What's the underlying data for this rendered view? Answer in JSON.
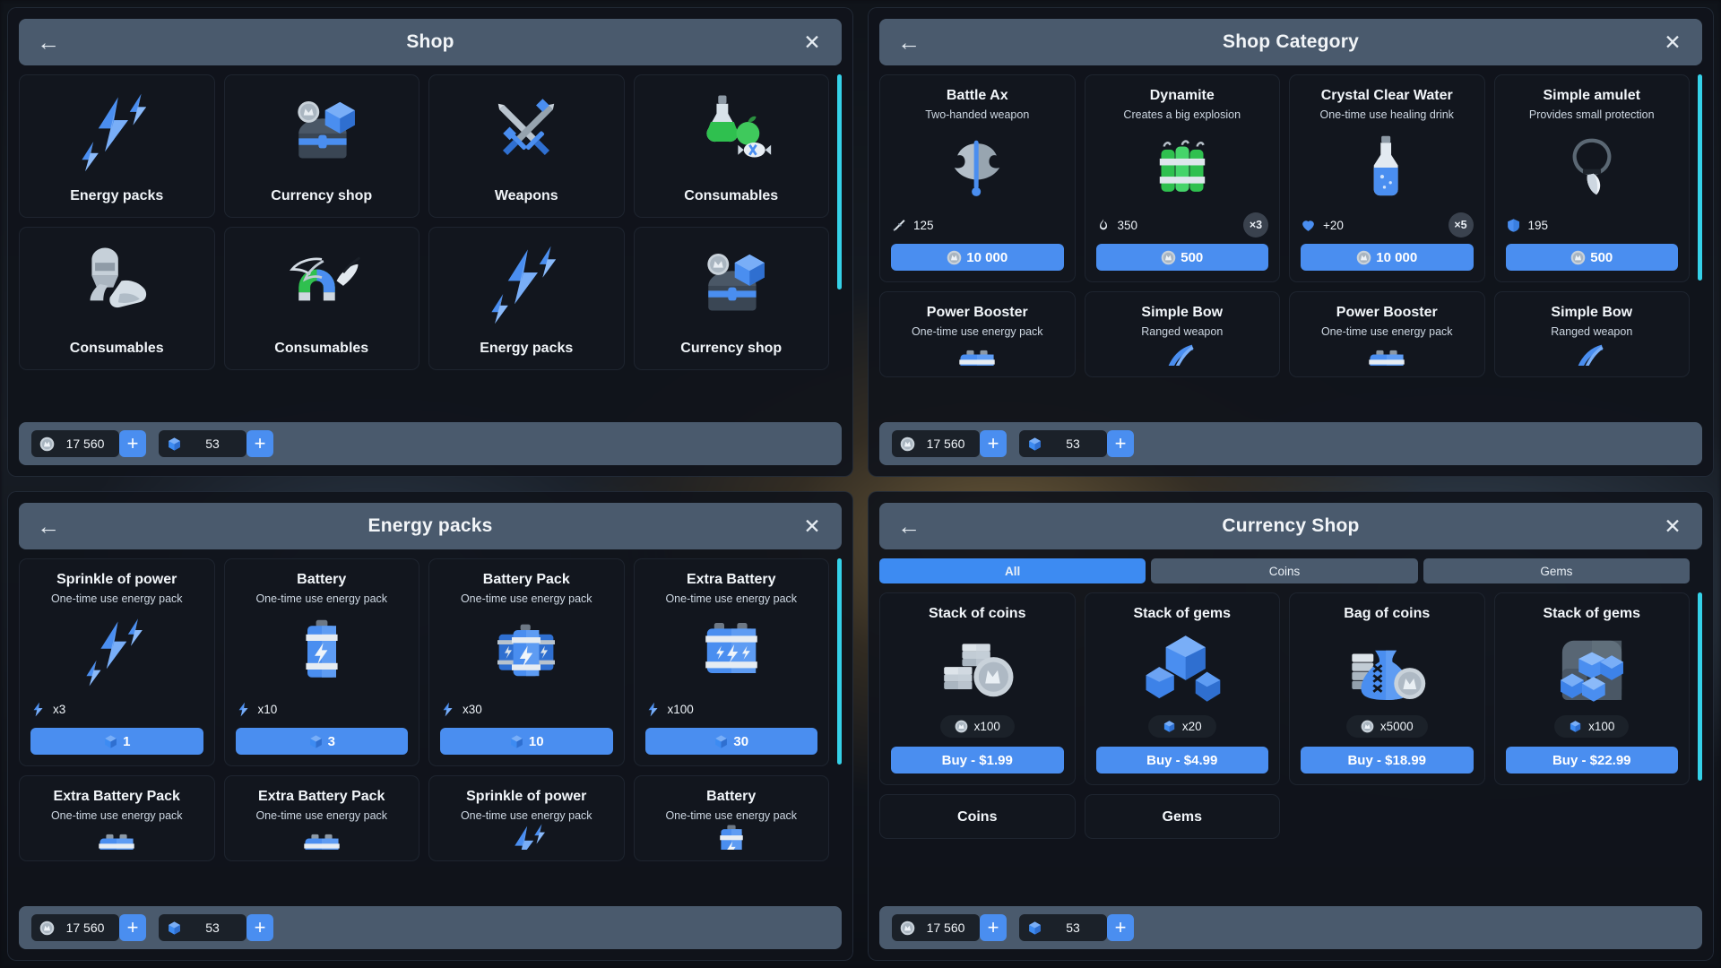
{
  "currency": {
    "coins": "17 560",
    "gems": "53",
    "add_label": "+"
  },
  "panels": {
    "shop": {
      "title": "Shop",
      "back_icon": "arrow-left-icon",
      "close_icon": "close-icon",
      "categories": [
        {
          "label": "Energy packs",
          "art": "lightning"
        },
        {
          "label": "Currency shop",
          "art": "chest-gem"
        },
        {
          "label": "Weapons",
          "art": "swords"
        },
        {
          "label": "Consumables",
          "art": "potion-candy"
        },
        {
          "label": "Consumables",
          "art": "armor"
        },
        {
          "label": "Consumables",
          "art": "magnet-feather"
        },
        {
          "label": "Energy packs",
          "art": "lightning"
        },
        {
          "label": "Currency shop",
          "art": "chest-gem"
        }
      ]
    },
    "shop_category": {
      "title": "Shop Category",
      "back_icon": "arrow-left-icon",
      "close_icon": "close-icon",
      "items": [
        {
          "name": "Battle Ax",
          "desc": "Two-handed weapon",
          "art": "axe",
          "stat_icon": "attack-icon",
          "stat": "125",
          "qty": "",
          "price_icon": "coin-icon",
          "price": "10 000"
        },
        {
          "name": "Dynamite",
          "desc": "Creates a big explosion",
          "art": "dynamite",
          "stat_icon": "fire-icon",
          "stat": "350",
          "qty": "×3",
          "price_icon": "coin-icon",
          "price": "500"
        },
        {
          "name": "Crystal Clear Water",
          "desc": "One-time use healing drink",
          "art": "bottle",
          "stat_icon": "heart-icon",
          "stat": "+20",
          "qty": "×5",
          "price_icon": "coin-icon",
          "price": "10 000"
        },
        {
          "name": "Simple amulet",
          "desc": "Provides small protection",
          "art": "amulet",
          "stat_icon": "shield-icon",
          "stat": "195",
          "qty": "",
          "price_icon": "coin-icon",
          "price": "500"
        }
      ],
      "items_row2": [
        {
          "name": "Power Booster",
          "desc": "One-time use energy pack",
          "art": "battery-wide"
        },
        {
          "name": "Simple Bow",
          "desc": "Ranged weapon",
          "art": "bow"
        },
        {
          "name": "Power Booster",
          "desc": "One-time use energy pack",
          "art": "battery-wide"
        },
        {
          "name": "Simple Bow",
          "desc": "Ranged weapon",
          "art": "bow"
        }
      ]
    },
    "energy_packs": {
      "title": "Energy packs",
      "back_icon": "arrow-left-icon",
      "close_icon": "close-icon",
      "items": [
        {
          "name": "Sprinkle of power",
          "desc": "One-time use energy pack",
          "art": "lightning",
          "stat_icon": "bolt-icon",
          "stat": "x3",
          "price_icon": "gem-icon",
          "price": "1"
        },
        {
          "name": "Battery",
          "desc": "One-time use energy pack",
          "art": "battery",
          "stat_icon": "bolt-icon",
          "stat": "x10",
          "price_icon": "gem-icon",
          "price": "3"
        },
        {
          "name": "Battery Pack",
          "desc": "One-time use energy pack",
          "art": "battery-triple",
          "stat_icon": "bolt-icon",
          "stat": "x30",
          "price_icon": "gem-icon",
          "price": "10"
        },
        {
          "name": "Extra Battery",
          "desc": "One-time use energy pack",
          "art": "battery-wide-big",
          "stat_icon": "bolt-icon",
          "stat": "x100",
          "price_icon": "gem-icon",
          "price": "30"
        }
      ],
      "items_row2": [
        {
          "name": "Extra Battery Pack",
          "desc": "One-time use energy pack",
          "art": "battery-wide"
        },
        {
          "name": "Extra Battery Pack",
          "desc": "One-time use energy pack",
          "art": "battery-wide"
        },
        {
          "name": "Sprinkle of power",
          "desc": "One-time use energy pack",
          "art": "lightning"
        },
        {
          "name": "Battery",
          "desc": "One-time use energy pack",
          "art": "battery"
        }
      ]
    },
    "currency_shop": {
      "title": "Currency Shop",
      "back_icon": "arrow-left-icon",
      "close_icon": "close-icon",
      "tabs": [
        {
          "label": "All",
          "active": true
        },
        {
          "label": "Coins",
          "active": false
        },
        {
          "label": "Gems",
          "active": false
        }
      ],
      "items": [
        {
          "name": "Stack of coins",
          "art": "coin-stack",
          "amount_icon": "coin-icon",
          "amount": "x100",
          "buy_label": "Buy - $1.99"
        },
        {
          "name": "Stack of gems",
          "art": "gems",
          "amount_icon": "gem-icon",
          "amount": "x20",
          "buy_label": "Buy - $4.99"
        },
        {
          "name": "Bag of coins",
          "art": "coin-bag",
          "amount_icon": "coin-icon",
          "amount": "x5000",
          "buy_label": "Buy - $18.99"
        },
        {
          "name": "Stack of gems",
          "art": "gem-chest",
          "amount_icon": "gem-icon",
          "amount": "x100",
          "buy_label": "Buy - $22.99"
        }
      ],
      "items_row2": [
        {
          "name": "Coins"
        },
        {
          "name": "Gems"
        }
      ]
    }
  },
  "colors": {
    "accent": "#4a8ef0",
    "header": "#4a5a6d",
    "card": "#12161e",
    "scrollbar": "#35d1e8",
    "gem": "#3d8bf2",
    "green": "#2fc04f"
  }
}
